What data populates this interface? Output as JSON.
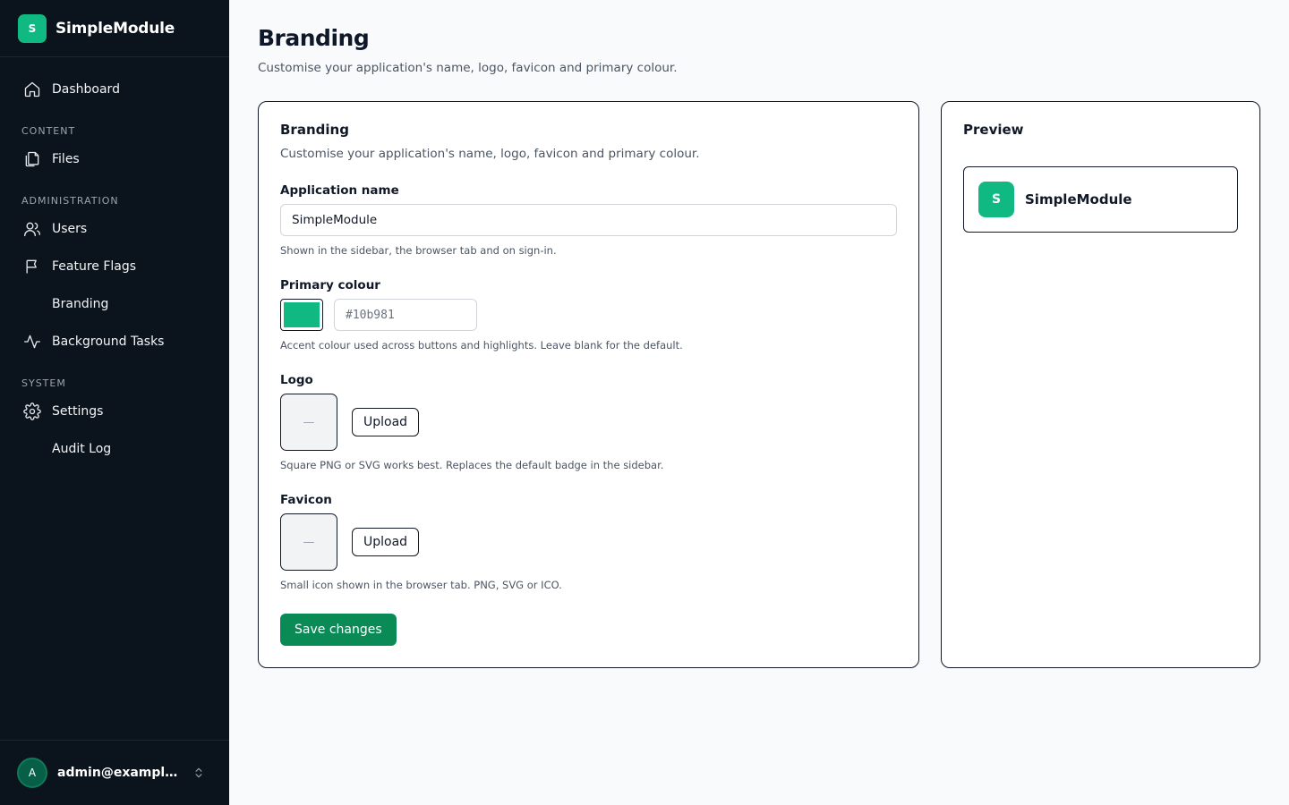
{
  "app": {
    "name": "SimpleModule",
    "badge_letter": "S",
    "accent_color": "#10b981"
  },
  "sidebar": {
    "items": [
      {
        "label": "Dashboard",
        "icon": "home-icon"
      },
      {
        "section": "CONTENT"
      },
      {
        "label": "Files",
        "icon": "files-icon"
      },
      {
        "section": "ADMINISTRATION"
      },
      {
        "label": "Users",
        "icon": "users-icon"
      },
      {
        "label": "Feature Flags",
        "icon": "flag-icon"
      },
      {
        "label": "Branding",
        "icon": ""
      },
      {
        "label": "Background Tasks",
        "icon": "activity-icon"
      },
      {
        "section": "SYSTEM"
      },
      {
        "label": "Settings",
        "icon": "gear-icon"
      },
      {
        "label": "Audit Log",
        "icon": ""
      }
    ],
    "footer": {
      "avatar_letter": "A",
      "user_email": "admin@example.co..."
    }
  },
  "page": {
    "title": "Branding",
    "subtitle": "Customise your application's name, logo, favicon and primary colour."
  },
  "form": {
    "title": "Branding",
    "description": "Customise your application's name, logo, favicon and primary colour.",
    "app_name": {
      "label": "Application name",
      "value": "SimpleModule",
      "hint": "Shown in the sidebar, the browser tab and on sign-in."
    },
    "primary_colour": {
      "label": "Primary colour",
      "value": "#10b981",
      "placeholder": "#10b981",
      "hint": "Accent colour used across buttons and highlights. Leave blank for the default."
    },
    "logo": {
      "label": "Logo",
      "placeholder_glyph": "—",
      "upload_label": "Upload",
      "hint": "Square PNG or SVG works best. Replaces the default badge in the sidebar."
    },
    "favicon": {
      "label": "Favicon",
      "placeholder_glyph": "—",
      "upload_label": "Upload",
      "hint": "Small icon shown in the browser tab. PNG, SVG or ICO."
    },
    "save_label": "Save changes"
  },
  "preview": {
    "title": "Preview",
    "badge_letter": "S",
    "app_name": "SimpleModule"
  }
}
